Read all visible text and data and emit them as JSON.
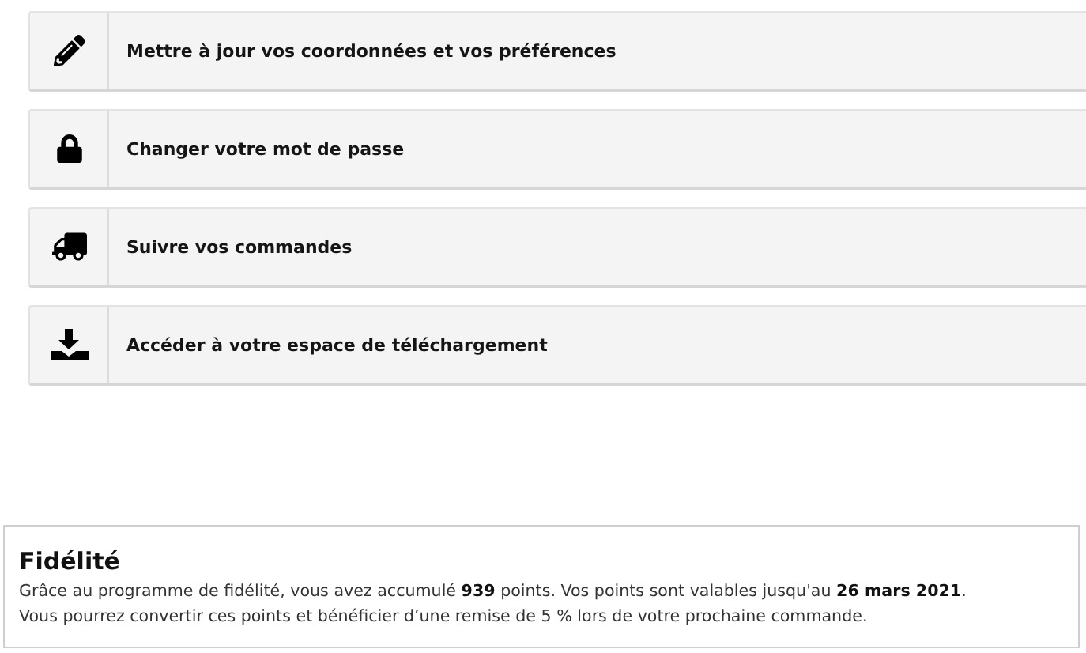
{
  "links": [
    {
      "kind": "edit",
      "label": "Mettre à jour vos coordonnées et vos préférences"
    },
    {
      "kind": "lock",
      "label": "Changer votre mot de passe"
    },
    {
      "kind": "truck",
      "label": "Suivre vos commandes"
    },
    {
      "kind": "download",
      "label": "Accéder à votre espace de téléchargement"
    }
  ],
  "loyalty": {
    "title": "Fidélité",
    "lines": [
      "Grâce au programme de fidélité, vous avez accumulé **939** points. Vos points sont valables jusqu'au **26 mars 2021**.",
      "Vous pourrez convertir ces points et bénéficier d’une remise de 5 % lors de votre prochaine commande."
    ]
  }
}
